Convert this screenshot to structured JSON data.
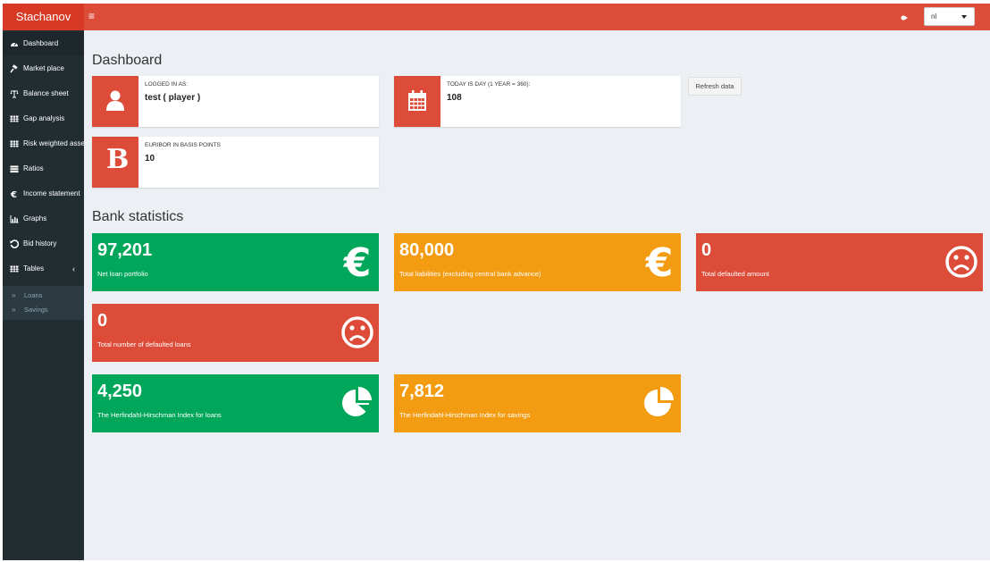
{
  "header": {
    "brand": "Stachanov",
    "menu_toggle": "≡",
    "language": {
      "selected": "nl"
    }
  },
  "sidebar": {
    "items": [
      {
        "label": "Dashboard",
        "icon": "dashboard-icon",
        "active": true
      },
      {
        "label": "Market place",
        "icon": "gavel-icon"
      },
      {
        "label": "Balance sheet",
        "icon": "balance-scale-icon"
      },
      {
        "label": "Gap analysis",
        "icon": "table-icon"
      },
      {
        "label": "Risk weighted assets",
        "icon": "table-icon"
      },
      {
        "label": "Ratios",
        "icon": "list-icon"
      },
      {
        "label": "Income statement",
        "icon": "euro-icon"
      },
      {
        "label": "Graphs",
        "icon": "bar-chart-icon"
      },
      {
        "label": "Bid history",
        "icon": "history-icon"
      },
      {
        "label": "Tables",
        "icon": "table-icon",
        "chevron": "‹"
      }
    ],
    "subitems": [
      {
        "label": "Loans",
        "arrow": "»"
      },
      {
        "label": "Savings",
        "arrow": "»"
      }
    ]
  },
  "dashboard": {
    "title": "Dashboard",
    "logged_in": {
      "caption": "LOGGED IN AS:",
      "value": "test ( player )",
      "icon": "user-icon"
    },
    "today": {
      "caption": "TODAY IS DAY (1 YEAR = 360):",
      "value": "108",
      "icon": "calendar-icon"
    },
    "euribor": {
      "caption": "EURIBOR IN BASIS POINTS",
      "value": "10",
      "icon_text": "B"
    },
    "refresh_label": "Refresh data"
  },
  "stats": {
    "title": "Bank statistics",
    "net_loan": {
      "value": "97,201",
      "label": "Net loan portfolio",
      "icon": "euro-icon",
      "color": "#00a65a"
    },
    "liabilities": {
      "value": "80,000",
      "label": "Total liabilities (excluding central bank advance)",
      "icon": "euro-icon",
      "color": "#f39c12"
    },
    "defaulted_amount": {
      "value": "0",
      "label": "Total defaulted amount",
      "icon": "frown-icon",
      "color": "#dd4b39"
    },
    "defaulted_loans": {
      "value": "0",
      "label": "Total number of defaulted loans",
      "icon": "frown-icon",
      "color": "#dd4b39"
    },
    "hhi_loans": {
      "value": "4,250",
      "label": "The Herfindahl-Hirschman Index for loans",
      "icon": "pie-chart-icon",
      "color": "#00a65a"
    },
    "hhi_savings": {
      "value": "7,812",
      "label": "The Herfindahl-Hirschman Index for savings",
      "icon": "pie-chart-icon",
      "color": "#f39c12"
    }
  }
}
